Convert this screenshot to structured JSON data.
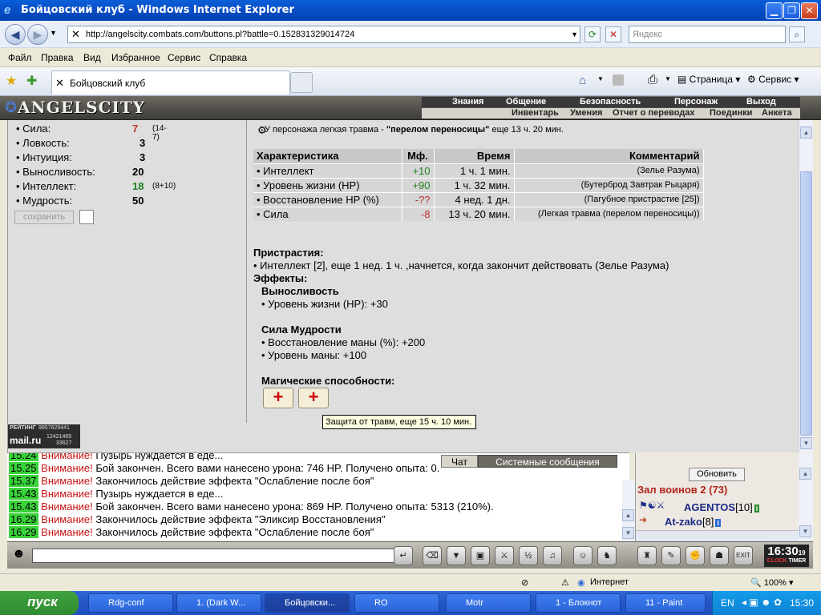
{
  "window": {
    "title": "Бойцовский клуб - Windows Internet Explorer"
  },
  "address": {
    "url": "http://angelscity.combats.com/buttons.pl?battle=0.152831329014724",
    "search_placeholder": "Яндекс"
  },
  "menu": [
    "Файл",
    "Правка",
    "Вид",
    "Избранное",
    "Сервис",
    "Справка"
  ],
  "tab": {
    "title": "Бойцовский клуб"
  },
  "ie_toolbar": {
    "page": "Страница",
    "service": "Сервис"
  },
  "game": {
    "logo": "ANGELSCITY",
    "nav1": [
      "Знания",
      "Общение",
      "Безопасность",
      "Персонаж",
      "Выход"
    ],
    "nav2": [
      "Инвентарь",
      "Умения",
      "Отчет о переводах",
      "Поединки",
      "Анкета"
    ]
  },
  "stats": [
    {
      "name": "• Сила:",
      "value": "7",
      "extra": "(14-7)",
      "color": "#c03030"
    },
    {
      "name": "• Ловкость:",
      "value": "3",
      "extra": "",
      "color": "#000000"
    },
    {
      "name": "• Интуиция:",
      "value": "3",
      "extra": "",
      "color": "#000000"
    },
    {
      "name": "• Выносливость:",
      "value": "20",
      "extra": "",
      "color": "#000000"
    },
    {
      "name": "• Интеллект:",
      "value": "18",
      "extra": "(8+10)",
      "color": "#208020"
    },
    {
      "name": "• Мудрость:",
      "value": "50",
      "extra": "",
      "color": "#000000"
    }
  ],
  "save_label": "сохранить",
  "injury": {
    "text": "У персонажа легкая травма - ",
    "bold": "\"перелом переносицы\"",
    "rest": " еще 13 ч. 20 мин."
  },
  "table": {
    "headers": [
      "Характеристика",
      "Мф.",
      "Время",
      "Комментарий"
    ],
    "rows": [
      {
        "c": "• Интеллект",
        "m": "+10",
        "t": "1 ч. 1 мин.",
        "k": "(Зелье Разума)",
        "cls": "green"
      },
      {
        "c": "• Уровень жизни (HP)",
        "m": "+90",
        "t": "1 ч. 32 мин.",
        "k": "(Бутерброд Завтрак Рыцаря)",
        "cls": "green"
      },
      {
        "c": "• Восстановление HP (%)",
        "m": "-??",
        "t": "4 нед. 1 дн.",
        "k": "(Пагубное пристрастие [25])",
        "cls": "red"
      },
      {
        "c": "• Сила",
        "m": "-8",
        "t": "13 ч. 20 мин.",
        "k": "(Легкая травма (перелом переносицы))",
        "cls": "red"
      }
    ]
  },
  "addictions": {
    "title": "Пристрастия:",
    "line": "• Интеллект [2], еще 1 нед. 1 ч. ,начнется, когда закончит действовать (Зелье Разума)"
  },
  "effects": {
    "title": "Эффекты:",
    "endurance": {
      "title": "Выносливость",
      "line": "• Уровень жизни (HP): +30"
    },
    "wisdom": {
      "title": "Сила Мудрости",
      "line1": "• Восстановление маны (%): +200",
      "line2": "• Уровень маны: +100"
    },
    "magic": "Магические способности:"
  },
  "tooltip": "Защита от травм, еще 15 ч. 10 мин.",
  "rating": {
    "label": "РЕЙТИНГ",
    "n1": "9857629441",
    "brand": "mail.ru",
    "n2": "12421465",
    "n3": "33627"
  },
  "chat": {
    "tab_chat": "Чат",
    "tab_system": "Системные сообщения",
    "lines": [
      {
        "time": "15.24",
        "warn": "Внимание!",
        "text": " Пузырь нуждается в еде..."
      },
      {
        "time": "15.25",
        "warn": "Внимание!",
        "text": " Бой закончен. Всего вами нанесено урона: 746 HP. Получено опыта: 0."
      },
      {
        "time": "15.37",
        "warn": "Внимание!",
        "text": " Закончилось действие эффекта \"Ослабление после боя\""
      },
      {
        "time": "15.43",
        "warn": "Внимание!",
        "text": " Пузырь нуждается в еде..."
      },
      {
        "time": "15.43",
        "warn": "Внимание!",
        "text": " Бой закончен. Всего вами нанесено урона: 869 HP. Получено опыта: 5313 (210%)."
      },
      {
        "time": "16.29",
        "warn": "Внимание!",
        "text": " Закончилось действие эффекта \"Эликсир Восстановления\""
      },
      {
        "time": "16.29",
        "warn": "Внимание!",
        "text": " Закончилось действие эффекта \"Ослабление после боя\""
      }
    ]
  },
  "room": {
    "refresh": "Обновить",
    "hall": "Зал воинов 2 (73)",
    "players": [
      {
        "name": "AGENTOS",
        "level": "[10]"
      },
      {
        "name": "At-zako",
        "level": "[8]"
      }
    ]
  },
  "clock": {
    "time": "16:30",
    "sec": "19",
    "l1": "CLOCK",
    "l2": "TIMER"
  },
  "statusbar": {
    "zone": "Интернет",
    "zoom": "100%"
  },
  "taskbar": {
    "start": "пуск",
    "items": [
      "Rdg-conf",
      "1. (Dark W...",
      "Бойцовски...",
      "RO",
      "Motr",
      "1 - Блокнот",
      "11 - Paint"
    ],
    "lang": "EN",
    "time": "15:30"
  }
}
